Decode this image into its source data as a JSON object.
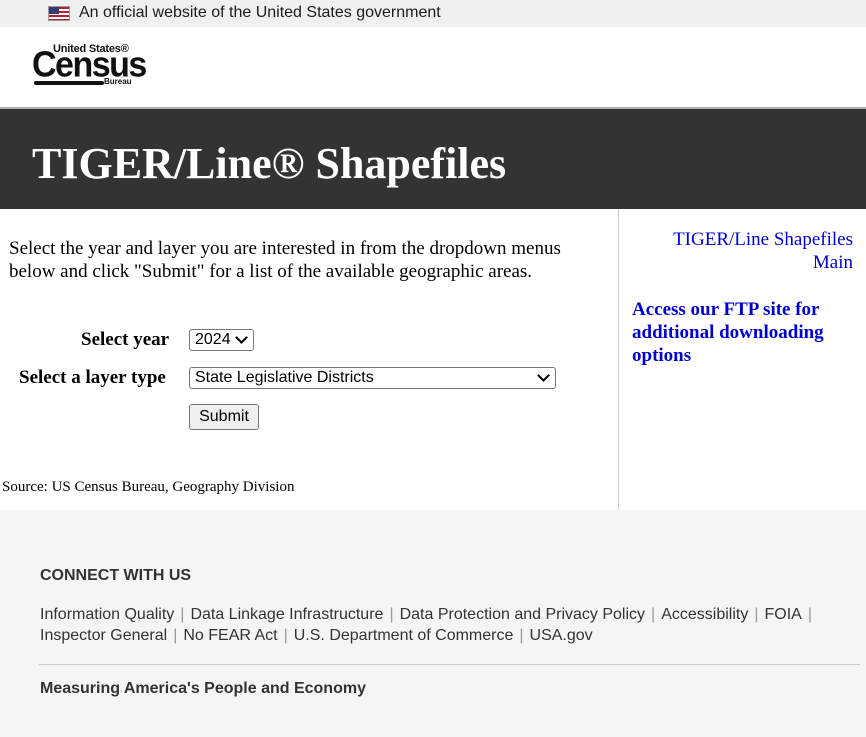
{
  "gov_banner": {
    "text": "An official website of the United States government",
    "flag_icon": "us-flag-icon"
  },
  "logo": {
    "line1": "United States®",
    "line2": "Census",
    "line3": "Bureau"
  },
  "page": {
    "title": "TIGER/Line® Shapefiles"
  },
  "main": {
    "intro": "Select the year and layer you are interested in from the dropdown menus below and click \"Submit\" for a list of the available geographic areas.",
    "year_label": "Select year",
    "year_value": "2024",
    "layer_label": "Select a layer type",
    "layer_value": "State Legislative Districts",
    "submit_label": "Submit",
    "source": "Source: US Census Bureau, Geography Division"
  },
  "sidebar": {
    "main_link": "TIGER/Line Shapefiles Main",
    "ftp_link": "Access our FTP site for additional downloading options"
  },
  "footer": {
    "connect": "CONNECT WITH US",
    "links_row1": [
      "Information Quality",
      "Data Linkage Infrastructure",
      "Data Protection and Privacy Policy",
      "Accessibility",
      "FOIA"
    ],
    "links_row2": [
      "Inspector General",
      "No FEAR Act",
      "U.S. Department of Commerce",
      "USA.gov"
    ],
    "separator": "|",
    "tagline": "Measuring America's People and Economy"
  },
  "colors": {
    "title_bar": "#333333",
    "link": "#0000cc",
    "footer_bg": "#f5f5f5",
    "banner_bg": "#f0f0f0"
  }
}
